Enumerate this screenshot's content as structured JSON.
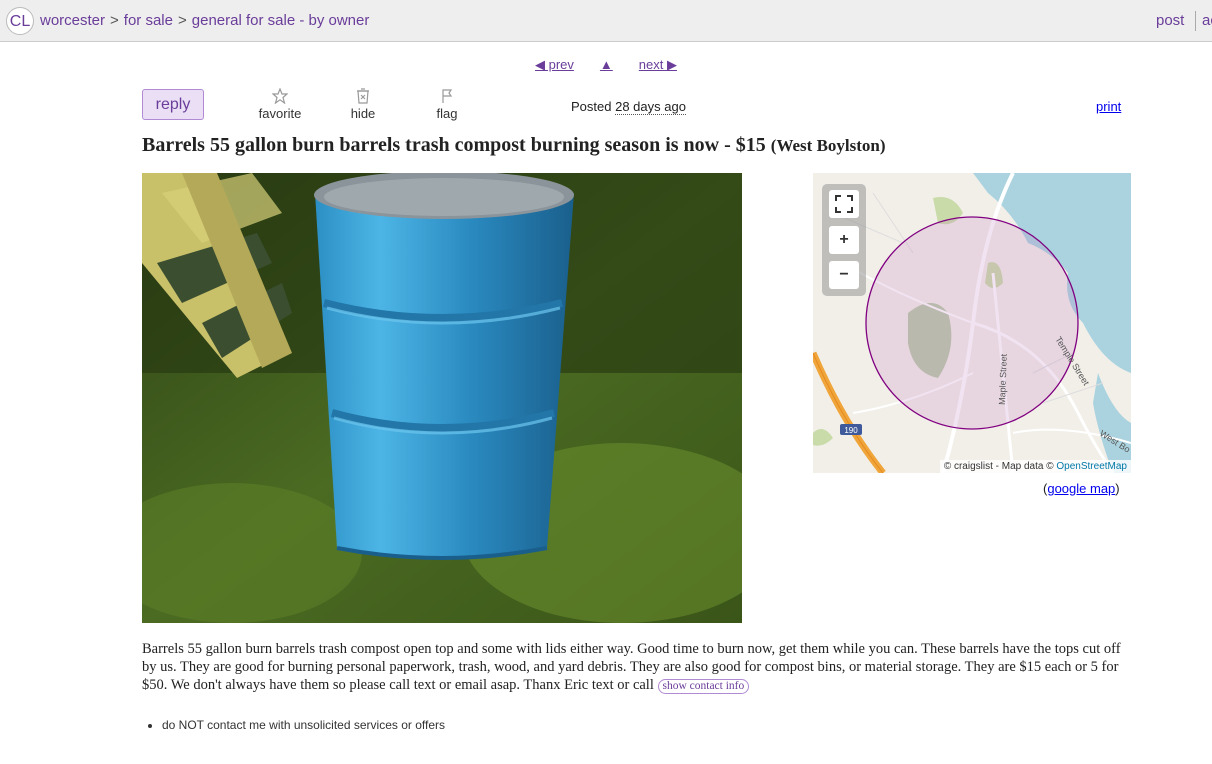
{
  "header": {
    "logo": "CL",
    "breadcrumbs": [
      "worcester",
      "for sale",
      "general for sale - by owner"
    ],
    "breadcrumb_sep": ">",
    "post_label": "post",
    "account_label": "account"
  },
  "nav": {
    "prev": "◀ prev",
    "up": "▲",
    "next": "next ▶"
  },
  "actions": {
    "reply": "reply",
    "favorite": "favorite",
    "hide": "hide",
    "flag": "flag",
    "posted_prefix": "Posted",
    "posted_ago": "28 days ago",
    "print": "print"
  },
  "listing": {
    "title": "Barrels 55 gallon burn barrels trash compost burning season is now",
    "price_sep": " - ",
    "price": "$15",
    "location": "(West Boylston)",
    "body": "Barrels 55 gallon burn barrels trash compost open top and some with lids either way. Good time to burn now, get them while you can. These barrels have the tops cut off by us. They are good for burning personal paperwork, trash, wood, and yard debris. They are also good for compost bins, or material storage. They are $15 each or 5 for $50. We don't always have them so please call text or email asap. Thanx Eric text or call",
    "contact_button": "show contact info",
    "notices": [
      "do NOT contact me with unsolicited services or offers"
    ]
  },
  "map": {
    "zoom_in": "+",
    "zoom_out": "−",
    "street_1": "Maple Street",
    "street_2": "Temple Street",
    "street_3": "West Bo",
    "highway": "190",
    "attribution_prefix": "© craigslist - Map data ©",
    "attribution_osm": "OpenStreetMap",
    "google_map_label": "google map"
  },
  "colors": {
    "link": "#0000ee",
    "visited": "#6a3d9a",
    "topbar_bg": "#eeeeee",
    "reply_bg": "#eadff5",
    "map_circle": "#800080"
  }
}
